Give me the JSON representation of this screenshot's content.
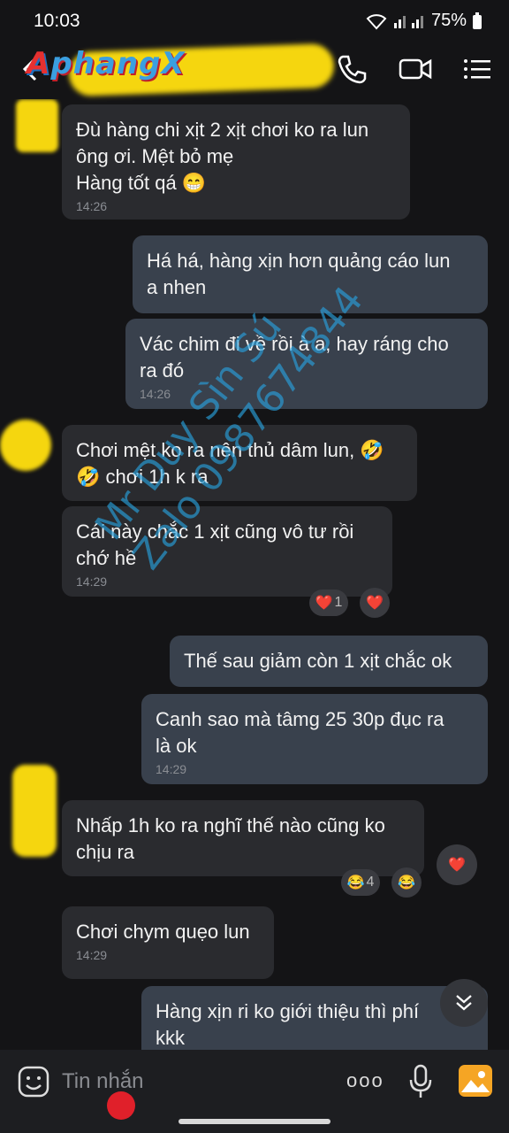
{
  "status": {
    "time": "10:03",
    "battery": "75%"
  },
  "header": {
    "logo_first": "A",
    "logo_rest": "phangX"
  },
  "messages": [
    {
      "dir": "in",
      "lines": [
        "Đù hàng chi xịt 2 xịt chơi ko ra lun",
        "ông ơi. Mệt bỏ mẹ",
        "Hàng tốt qá 😁"
      ],
      "time": "14:26"
    },
    {
      "dir": "out",
      "lines": [
        "Há há, hàng xịn hơn quảng cáo lun",
        "a nhen"
      ],
      "time": ""
    },
    {
      "dir": "out",
      "lines": [
        "Vác chim đi về rồi à a, hay ráng cho",
        "ra đó"
      ],
      "time": "14:26"
    },
    {
      "dir": "in",
      "lines": [
        "Chơi mệt ko ra nên thủ dâm lun, 🤣",
        "🤣 chơi 1h k ra"
      ],
      "time": ""
    },
    {
      "dir": "in",
      "lines": [
        "Cái này chắc 1 xịt cũng vô tư rồi",
        "chớ hề"
      ],
      "time": "14:29"
    },
    {
      "dir": "out",
      "lines": [
        "Thế sau giảm còn 1 xịt chắc ok"
      ],
      "time": ""
    },
    {
      "dir": "out",
      "lines": [
        "Canh sao mà tâmg 25 30p đục ra",
        "là ok"
      ],
      "time": "14:29"
    },
    {
      "dir": "in",
      "lines": [
        "Nhấp 1h ko ra nghĩ thế nào cũng ko",
        "chịu ra"
      ],
      "time": ""
    },
    {
      "dir": "in",
      "lines": [
        "Chơi chym quẹo lun"
      ],
      "time": "14:29"
    },
    {
      "dir": "out",
      "lines": [
        "Hàng xịn ri ko giới thiệu thì phí",
        "kkk"
      ],
      "time": ""
    }
  ],
  "reactions": {
    "r1_emoji": "❤️",
    "r1_count": "1",
    "r2_emoji": "❤️",
    "r3_emoji": "❤️",
    "r4_emoji": "😂",
    "r4_count": "4",
    "r5_emoji": "😂"
  },
  "watermark": {
    "line1": "Mr Duy Sìn Sú",
    "line2": "Zalo 0987674844"
  },
  "composer": {
    "placeholder": "Tin nhắn",
    "more": "ooo"
  },
  "colors": {
    "bubble_in": "#2a2b2f",
    "bubble_out": "#39414d",
    "background": "#141416",
    "blur_yellow": "#f5d60f"
  },
  "icons": [
    "back-icon",
    "phone-icon",
    "video-call-icon",
    "menu-list-icon",
    "emoji-icon",
    "more-icon",
    "mic-icon",
    "photo-icon",
    "chevron-down-icon"
  ]
}
